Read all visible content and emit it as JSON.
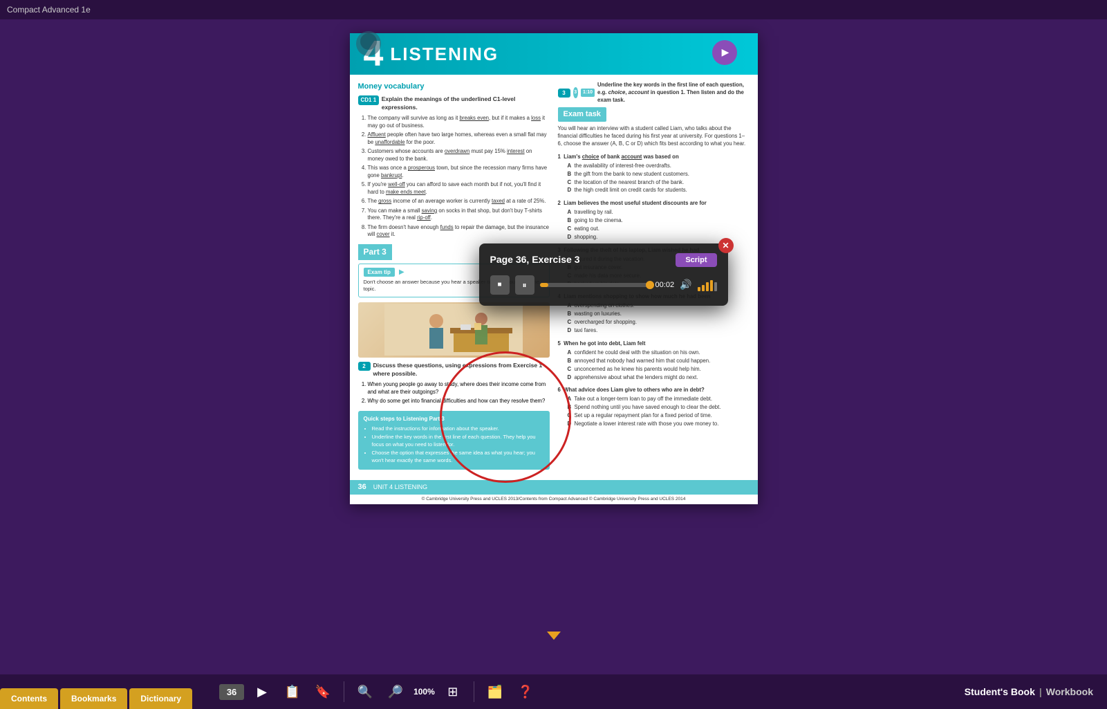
{
  "app": {
    "title": "Compact Advanced 1e"
  },
  "tabs": {
    "contents": "Contents",
    "bookmarks": "Bookmarks",
    "dictionary": "Dictionary"
  },
  "toolbar": {
    "page_number": "36",
    "zoom_percent": "100%",
    "student_book": "Student's Book",
    "workbook": "Workbook",
    "separator": "|"
  },
  "page": {
    "unit": "4",
    "section": "LISTENING",
    "section_title": "Money vocabulary",
    "exercise1_badge": "CD1",
    "exercise1_instruction": "Explain the meanings of the underlined C1-level expressions.",
    "exercise1_items": [
      "The company will survive as long as it breaks even, but if it makes a loss it may go out of business.",
      "Affluent people often have two large homes, whereas even a small flat may be unaffordable for the poor.",
      "Customers whose accounts are overdrawn must pay 15% interest on money owed to the bank.",
      "This was once a prosperous town, but since the recession many firms have gone bankrupt.",
      "If you're well-off you can afford to save each month but if not, you'll find it hard to make ends meet.",
      "The gross income of an average worker is currently taxed at a rate of 25%.",
      "You can make a small saving on socks in that shop, but don't buy T-shirts there. They're a real rip-off.",
      "The firm doesn't have enough funds to repair the damage, but the insurance will cover it."
    ],
    "part3_label": "Part 3",
    "exam_tip_label": "Exam tip",
    "exam_tip_arrow": "▶",
    "exam_tip_text": "Don't choose an answer because you hear a speaker talking about the same topic.",
    "exercise2_instruction": "Discuss these questions, using expressions from Exercise 1 where possible.",
    "exercise2_items": [
      "When young people go away to study, where does their income come from and what are their outgoings?",
      "Why do some get into financial difficulties and how can they resolve them?"
    ],
    "quick_steps_title": "Quick steps to Listening Part 3",
    "quick_steps_items": [
      "Read the instructions for information about the speaker.",
      "Underline the key words in the first line of each question. They help you focus on what you need to listen for.",
      "Choose the option that expresses the same idea as what you hear; you won't hear exactly the same words."
    ],
    "exercise3_num": "3",
    "exercise3_audio": "3",
    "exercise3_track": "1:10",
    "exercise3_instruction": "Underline the key words in the first line of each question, e.g. choice, account in question 1. Then listen and do the exam task.",
    "exam_task_label": "Exam task",
    "exam_task_intro": "You will hear an interview with a student called Liam, who talks about the financial difficulties he faced during his first year at university. For questions 1–6, choose the answer (A, B, C or D) which fits best according to what you hear.",
    "exam_questions": [
      {
        "num": "1",
        "question": "Liam's choice of bank account was based on",
        "options": [
          {
            "letter": "A",
            "text": "the availability of interest-free overdrafts."
          },
          {
            "letter": "B",
            "text": "the gift from the bank to new student customers."
          },
          {
            "letter": "C",
            "text": "the location of the nearest branch of the bank."
          },
          {
            "letter": "D",
            "text": "the high credit limit on credit cards for students."
          }
        ]
      },
      {
        "num": "2",
        "question": "Liam believes the most useful student discounts are for",
        "options": [
          {
            "letter": "A",
            "text": "travelling by rail."
          },
          {
            "letter": "B",
            "text": "going to the cinema."
          },
          {
            "letter": "C",
            "text": "eating out."
          },
          {
            "letter": "D",
            "text": "shopping."
          }
        ]
      },
      {
        "num": "3",
        "question": "Following the theft of his laptop, Liam wished he had",
        "options": [
          {
            "letter": "A",
            "text": "insured it during the vacation."
          },
          {
            "letter": "B",
            "text": "got insurance cover."
          },
          {
            "letter": "C",
            "text": "made his data more secure."
          },
          {
            "letter": "D",
            "text": "backed up his data."
          }
        ]
      },
      {
        "num": "4",
        "question": "Liam mentions shopping to show how much he had been",
        "options": [
          {
            "letter": "A",
            "text": "overspending on clothes."
          },
          {
            "letter": "B",
            "text": "wasting on luxuries."
          },
          {
            "letter": "C",
            "text": "overcharged for shopping."
          },
          {
            "letter": "D",
            "text": "taxi fares."
          }
        ]
      },
      {
        "num": "5",
        "question": "When he got into debt, Liam felt",
        "options": [
          {
            "letter": "A",
            "text": "confident he could deal with the situation on his own."
          },
          {
            "letter": "B",
            "text": "annoyed that nobody had warned him that could happen."
          },
          {
            "letter": "C",
            "text": "unconcerned as he knew his parents would help him."
          },
          {
            "letter": "D",
            "text": "apprehensive about what the lenders might do next."
          }
        ]
      },
      {
        "num": "6",
        "question": "What advice does Liam give to others who are in debt?",
        "options": [
          {
            "letter": "A",
            "text": "Take out a longer-term loan to pay off the immediate debt."
          },
          {
            "letter": "B",
            "text": "Spend nothing until you have saved enough to clear the debt."
          },
          {
            "letter": "C",
            "text": "Set up a regular repayment plan for a fixed period of time."
          },
          {
            "letter": "D",
            "text": "Negotiate a lower interest rate with those you owe money to."
          }
        ]
      }
    ],
    "footer_page_num": "36",
    "footer_unit": "UNIT 4  LISTENING",
    "copyright": "© Cambridge University Press and UCLES 2013/Contents from Compact Advanced © Cambridge University Press and UCLES 2014"
  },
  "audio_player": {
    "title": "Page 36, Exercise 3",
    "script_btn": "Script",
    "time": "00:02",
    "progress_percent": 8
  }
}
